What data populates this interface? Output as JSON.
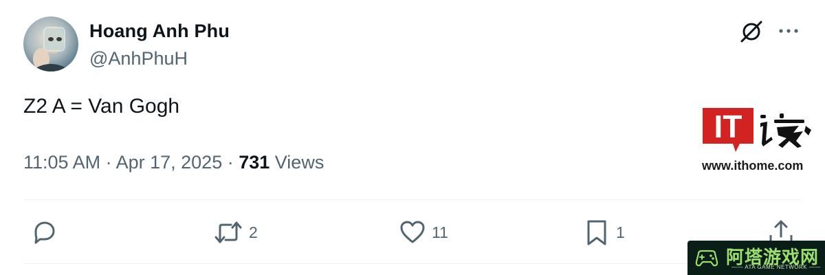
{
  "author": {
    "display_name": "Hoang Anh Phu",
    "handle": "@AnhPhuH"
  },
  "tweet": {
    "text": "Z2 A = Van Gogh",
    "time": "11:05 AM",
    "separator": " · ",
    "date": "Apr 17, 2025",
    "views_count": "731",
    "views_label": " Views"
  },
  "actions": {
    "replies": "",
    "retweets": "2",
    "likes": "11",
    "bookmarks": "1"
  },
  "watermark": {
    "site_url": "www.ithome.com",
    "brand_letters": "IT",
    "badge_cn": "阿塔游戏网",
    "badge_en": "—— ATA GAME NETWORK ——"
  },
  "icons": {
    "grok": "grok-icon",
    "more": "more-icon",
    "reply": "reply-icon",
    "retweet": "retweet-icon",
    "like": "heart-icon",
    "bookmark": "bookmark-icon",
    "share": "share-icon"
  },
  "colors": {
    "primary_text": "#0f1419",
    "secondary_text": "#536471",
    "divider": "#eff3f4",
    "ithome_red": "#d22222",
    "ata_green": "#9be06e"
  }
}
